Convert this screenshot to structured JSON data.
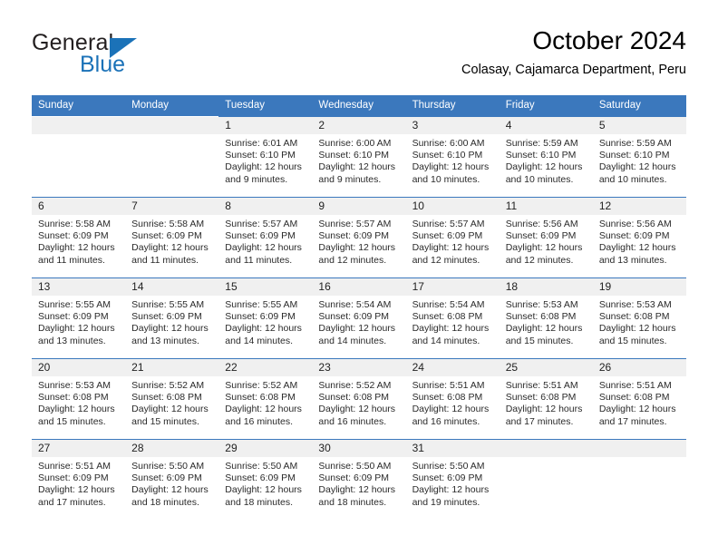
{
  "brand": {
    "name_top": "General",
    "name_bottom": "Blue",
    "accent_color": "#1b72b8"
  },
  "header": {
    "title": "October 2024",
    "subtitle": "Colasay, Cajamarca Department, Peru"
  },
  "calendar": {
    "header_color": "#3b78bd",
    "weekday_headers": [
      "Sunday",
      "Monday",
      "Tuesday",
      "Wednesday",
      "Thursday",
      "Friday",
      "Saturday"
    ],
    "labels": {
      "sunrise": "Sunrise:",
      "sunset": "Sunset:",
      "daylight": "Daylight:"
    },
    "weeks": [
      [
        {
          "day": "",
          "empty": true
        },
        {
          "day": "",
          "empty": true
        },
        {
          "day": "1",
          "sunrise": "Sunrise: 6:01 AM",
          "sunset": "Sunset: 6:10 PM",
          "daylight": "Daylight: 12 hours and 9 minutes."
        },
        {
          "day": "2",
          "sunrise": "Sunrise: 6:00 AM",
          "sunset": "Sunset: 6:10 PM",
          "daylight": "Daylight: 12 hours and 9 minutes."
        },
        {
          "day": "3",
          "sunrise": "Sunrise: 6:00 AM",
          "sunset": "Sunset: 6:10 PM",
          "daylight": "Daylight: 12 hours and 10 minutes."
        },
        {
          "day": "4",
          "sunrise": "Sunrise: 5:59 AM",
          "sunset": "Sunset: 6:10 PM",
          "daylight": "Daylight: 12 hours and 10 minutes."
        },
        {
          "day": "5",
          "sunrise": "Sunrise: 5:59 AM",
          "sunset": "Sunset: 6:10 PM",
          "daylight": "Daylight: 12 hours and 10 minutes."
        }
      ],
      [
        {
          "day": "6",
          "sunrise": "Sunrise: 5:58 AM",
          "sunset": "Sunset: 6:09 PM",
          "daylight": "Daylight: 12 hours and 11 minutes."
        },
        {
          "day": "7",
          "sunrise": "Sunrise: 5:58 AM",
          "sunset": "Sunset: 6:09 PM",
          "daylight": "Daylight: 12 hours and 11 minutes."
        },
        {
          "day": "8",
          "sunrise": "Sunrise: 5:57 AM",
          "sunset": "Sunset: 6:09 PM",
          "daylight": "Daylight: 12 hours and 11 minutes."
        },
        {
          "day": "9",
          "sunrise": "Sunrise: 5:57 AM",
          "sunset": "Sunset: 6:09 PM",
          "daylight": "Daylight: 12 hours and 12 minutes."
        },
        {
          "day": "10",
          "sunrise": "Sunrise: 5:57 AM",
          "sunset": "Sunset: 6:09 PM",
          "daylight": "Daylight: 12 hours and 12 minutes."
        },
        {
          "day": "11",
          "sunrise": "Sunrise: 5:56 AM",
          "sunset": "Sunset: 6:09 PM",
          "daylight": "Daylight: 12 hours and 12 minutes."
        },
        {
          "day": "12",
          "sunrise": "Sunrise: 5:56 AM",
          "sunset": "Sunset: 6:09 PM",
          "daylight": "Daylight: 12 hours and 13 minutes."
        }
      ],
      [
        {
          "day": "13",
          "sunrise": "Sunrise: 5:55 AM",
          "sunset": "Sunset: 6:09 PM",
          "daylight": "Daylight: 12 hours and 13 minutes."
        },
        {
          "day": "14",
          "sunrise": "Sunrise: 5:55 AM",
          "sunset": "Sunset: 6:09 PM",
          "daylight": "Daylight: 12 hours and 13 minutes."
        },
        {
          "day": "15",
          "sunrise": "Sunrise: 5:55 AM",
          "sunset": "Sunset: 6:09 PM",
          "daylight": "Daylight: 12 hours and 14 minutes."
        },
        {
          "day": "16",
          "sunrise": "Sunrise: 5:54 AM",
          "sunset": "Sunset: 6:09 PM",
          "daylight": "Daylight: 12 hours and 14 minutes."
        },
        {
          "day": "17",
          "sunrise": "Sunrise: 5:54 AM",
          "sunset": "Sunset: 6:08 PM",
          "daylight": "Daylight: 12 hours and 14 minutes."
        },
        {
          "day": "18",
          "sunrise": "Sunrise: 5:53 AM",
          "sunset": "Sunset: 6:08 PM",
          "daylight": "Daylight: 12 hours and 15 minutes."
        },
        {
          "day": "19",
          "sunrise": "Sunrise: 5:53 AM",
          "sunset": "Sunset: 6:08 PM",
          "daylight": "Daylight: 12 hours and 15 minutes."
        }
      ],
      [
        {
          "day": "20",
          "sunrise": "Sunrise: 5:53 AM",
          "sunset": "Sunset: 6:08 PM",
          "daylight": "Daylight: 12 hours and 15 minutes."
        },
        {
          "day": "21",
          "sunrise": "Sunrise: 5:52 AM",
          "sunset": "Sunset: 6:08 PM",
          "daylight": "Daylight: 12 hours and 15 minutes."
        },
        {
          "day": "22",
          "sunrise": "Sunrise: 5:52 AM",
          "sunset": "Sunset: 6:08 PM",
          "daylight": "Daylight: 12 hours and 16 minutes."
        },
        {
          "day": "23",
          "sunrise": "Sunrise: 5:52 AM",
          "sunset": "Sunset: 6:08 PM",
          "daylight": "Daylight: 12 hours and 16 minutes."
        },
        {
          "day": "24",
          "sunrise": "Sunrise: 5:51 AM",
          "sunset": "Sunset: 6:08 PM",
          "daylight": "Daylight: 12 hours and 16 minutes."
        },
        {
          "day": "25",
          "sunrise": "Sunrise: 5:51 AM",
          "sunset": "Sunset: 6:08 PM",
          "daylight": "Daylight: 12 hours and 17 minutes."
        },
        {
          "day": "26",
          "sunrise": "Sunrise: 5:51 AM",
          "sunset": "Sunset: 6:08 PM",
          "daylight": "Daylight: 12 hours and 17 minutes."
        }
      ],
      [
        {
          "day": "27",
          "sunrise": "Sunrise: 5:51 AM",
          "sunset": "Sunset: 6:09 PM",
          "daylight": "Daylight: 12 hours and 17 minutes."
        },
        {
          "day": "28",
          "sunrise": "Sunrise: 5:50 AM",
          "sunset": "Sunset: 6:09 PM",
          "daylight": "Daylight: 12 hours and 18 minutes."
        },
        {
          "day": "29",
          "sunrise": "Sunrise: 5:50 AM",
          "sunset": "Sunset: 6:09 PM",
          "daylight": "Daylight: 12 hours and 18 minutes."
        },
        {
          "day": "30",
          "sunrise": "Sunrise: 5:50 AM",
          "sunset": "Sunset: 6:09 PM",
          "daylight": "Daylight: 12 hours and 18 minutes."
        },
        {
          "day": "31",
          "sunrise": "Sunrise: 5:50 AM",
          "sunset": "Sunset: 6:09 PM",
          "daylight": "Daylight: 12 hours and 19 minutes."
        },
        {
          "day": "",
          "empty": true
        },
        {
          "day": "",
          "empty": true
        }
      ]
    ]
  }
}
